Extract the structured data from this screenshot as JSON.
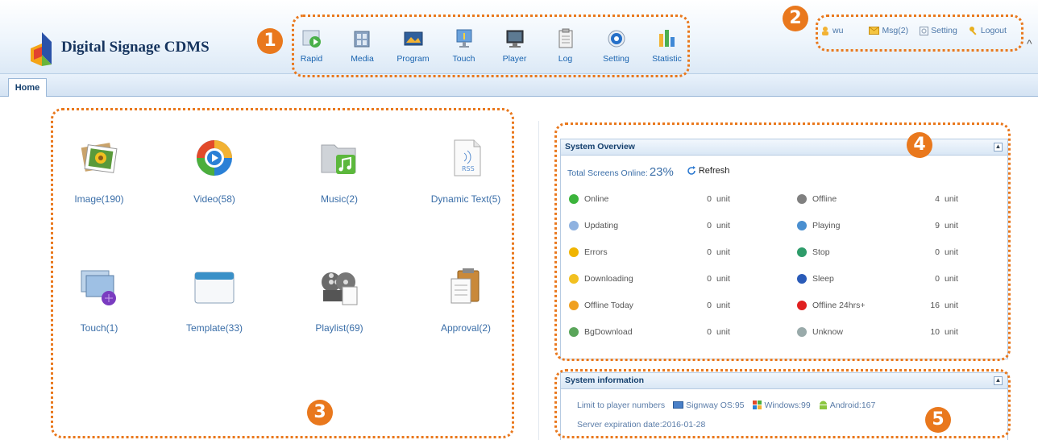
{
  "app": {
    "title": "Digital Signage CDMS"
  },
  "toolbar": {
    "items": [
      {
        "label": "Rapid"
      },
      {
        "label": "Media"
      },
      {
        "label": "Program"
      },
      {
        "label": "Touch"
      },
      {
        "label": "Player"
      },
      {
        "label": "Log"
      },
      {
        "label": "Setting"
      },
      {
        "label": "Statistic"
      }
    ]
  },
  "userbar": {
    "user": "wu",
    "msg": "Msg(2)",
    "setting": "Setting",
    "logout": "Logout"
  },
  "tabs": [
    {
      "label": "Home"
    }
  ],
  "shortcuts": [
    {
      "label": "Image(190)",
      "icon": "image-icon"
    },
    {
      "label": "Video(58)",
      "icon": "video-icon"
    },
    {
      "label": "Music(2)",
      "icon": "music-icon"
    },
    {
      "label": "Dynamic Text(5)",
      "icon": "rss-icon"
    },
    {
      "label": "Touch(1)",
      "icon": "touch-icon"
    },
    {
      "label": "Template(33)",
      "icon": "template-icon"
    },
    {
      "label": "Playlist(69)",
      "icon": "playlist-icon"
    },
    {
      "label": "Approval(2)",
      "icon": "approval-icon"
    }
  ],
  "overview": {
    "title": "System Overview",
    "online_label": "Total Screens Online:",
    "online_pct": "23%",
    "refresh": "Refresh",
    "unit": "unit",
    "stats_left": [
      {
        "name": "Online",
        "value": "0",
        "color": "#3cb43c"
      },
      {
        "name": "Updating",
        "value": "0",
        "color": "#8fb2e0"
      },
      {
        "name": "Errors",
        "value": "0",
        "color": "#f0b400"
      },
      {
        "name": "Downloading",
        "value": "0",
        "color": "#f2c020"
      },
      {
        "name": "Offline Today",
        "value": "0",
        "color": "#f0a020"
      },
      {
        "name": "BgDownload",
        "value": "0",
        "color": "#5aa55a"
      }
    ],
    "stats_right": [
      {
        "name": "Offline",
        "value": "4",
        "color": "#808080"
      },
      {
        "name": "Playing",
        "value": "9",
        "color": "#4a8fd0"
      },
      {
        "name": "Stop",
        "value": "0",
        "color": "#2e9c6a"
      },
      {
        "name": "Sleep",
        "value": "0",
        "color": "#2a5bb8"
      },
      {
        "name": "Offline 24hrs+",
        "value": "16",
        "color": "#e02020"
      },
      {
        "name": "Unknow",
        "value": "10",
        "color": "#9aa"
      }
    ]
  },
  "sysinfo": {
    "title": "System information",
    "limit_label": "Limit to player numbers",
    "signway": "Signway OS:95",
    "windows": "Windows:99",
    "android": "Android:167",
    "expiration": "Server expiration date:2016-01-28"
  },
  "callouts": [
    "1",
    "2",
    "3",
    "4",
    "5"
  ],
  "colors": {
    "accent": "#e9781d",
    "link": "#3a6ea8",
    "header_text": "#15406e"
  }
}
